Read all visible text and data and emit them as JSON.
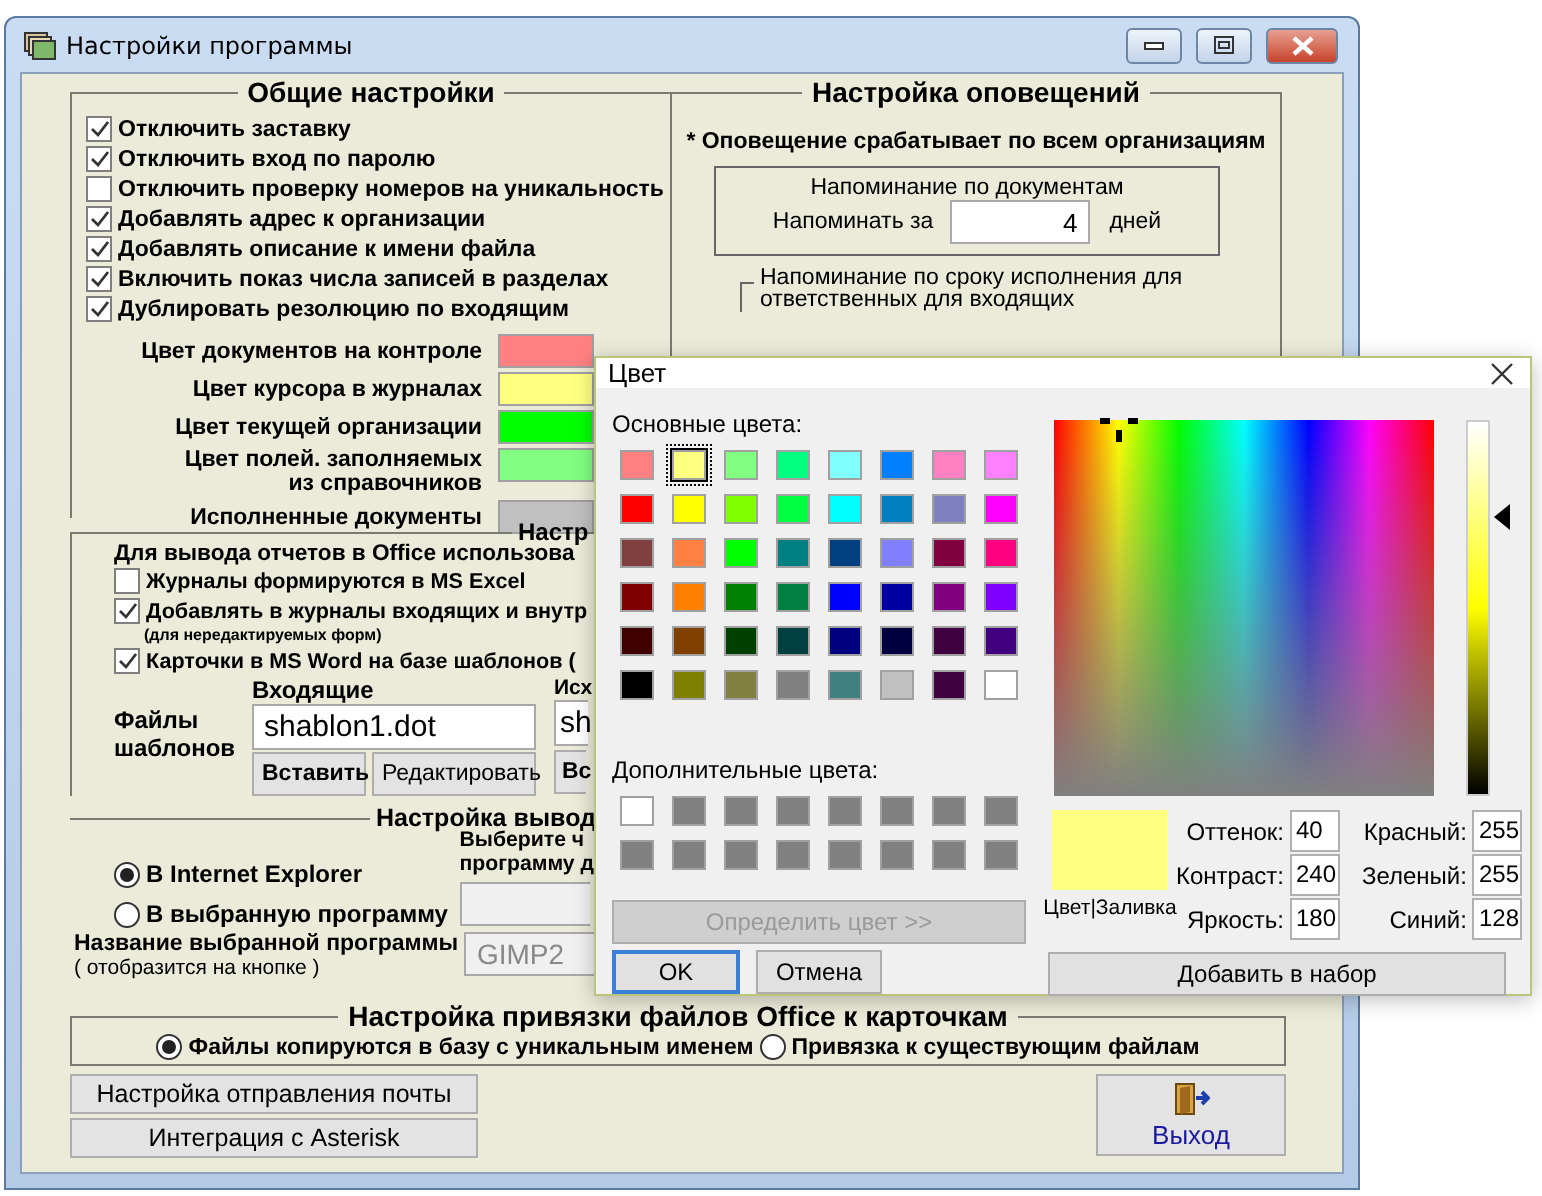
{
  "window": {
    "title": "Настройки программы"
  },
  "general": {
    "title": "Общие настройки",
    "options": [
      {
        "label": "Отключить заставку",
        "checked": true
      },
      {
        "label": "Отключить вход по паролю",
        "checked": true
      },
      {
        "label": "Отключить проверку номеров на уникальность",
        "checked": false
      },
      {
        "label": "Добавлять адрес к организации",
        "checked": true
      },
      {
        "label": "Добавлять описание к имени файла",
        "checked": true
      },
      {
        "label": "Включить показ числа записей в разделах",
        "checked": true
      },
      {
        "label": "Дублировать резолюцию по входящим",
        "checked": true
      }
    ],
    "colors": [
      {
        "label": "Цвет документов на контроле",
        "color": "#ff8080"
      },
      {
        "label": "Цвет курсора в журналах",
        "color": "#ffff80"
      },
      {
        "label": "Цвет текущей организации",
        "color": "#00ff00"
      },
      {
        "label": "Цвет полей. заполняемых\nиз справочников",
        "color": "#80ff80"
      },
      {
        "label": "Исполненные документы",
        "color": "#c0c0c0"
      }
    ]
  },
  "notifications": {
    "title": "Настройка оповещений",
    "note": "* Оповещение срабатывает по всем организациям",
    "documents": {
      "title": "Напоминание по документам",
      "label": "Напоминать за",
      "value": "4",
      "unit": "дней"
    },
    "deadline": {
      "title": "Напоминание по сроку исполнения для ответственных для входящих"
    }
  },
  "office": {
    "title": "Настр",
    "intro": "Для вывода отчетов в Office использова",
    "options": [
      {
        "label": "Журналы формируются в MS Excel",
        "checked": false
      },
      {
        "label": "Добавлять в журналы входящих и внутр",
        "checked": true,
        "note": "(для нередактируемых форм)"
      },
      {
        "label": "Карточки в MS Word на базе шаблонов (",
        "checked": true
      }
    ],
    "templates": {
      "label": "Файлы\nшаблонов",
      "incoming": {
        "title": "Входящие",
        "value": "shablon1.dot",
        "buttons": [
          "Вставить",
          "Редактировать"
        ]
      },
      "outgoing": {
        "title": "Исх",
        "value": "sh",
        "buttons": [
          "Вс"
        ]
      }
    }
  },
  "output": {
    "title": "Настройка вывод",
    "choices": [
      {
        "label": "В Internet Explorer",
        "selected": true
      },
      {
        "label": "В выбранную программу",
        "selected": false
      }
    ],
    "hint": "Выберите ч\nпрограмму д",
    "name_label": "Название выбранной программы",
    "name_note": "( отобразится на кнопке )",
    "name_value": "GIMP2"
  },
  "binding": {
    "title": "Настройка привязки файлов Office к карточкам",
    "choices": [
      {
        "label": "Файлы копируются в базу с уникальным именем",
        "selected": true
      },
      {
        "label": "Привязка к существующим файлам",
        "selected": false
      }
    ]
  },
  "buttons": [
    "Настройка отправления почты",
    "Интеграция с Asterisk"
  ],
  "exit": "Выход",
  "color_dialog": {
    "title": "Цвет",
    "basic_label": "Основные цвета:",
    "basic": [
      {
        "color": "#ff8080",
        "selected": false
      },
      {
        "color": "#ffff80",
        "selected": true
      },
      {
        "color": "#80ff80",
        "selected": false
      },
      {
        "color": "#00ff80",
        "selected": false
      },
      {
        "color": "#80ffff",
        "selected": false
      },
      {
        "color": "#0080ff",
        "selected": false
      },
      {
        "color": "#ff80c0",
        "selected": false
      },
      {
        "color": "#ff80ff",
        "selected": false
      },
      {
        "color": "#ff0000",
        "selected": false
      },
      {
        "color": "#ffff00",
        "selected": false
      },
      {
        "color": "#80ff00",
        "selected": false
      },
      {
        "color": "#00ff40",
        "selected": false
      },
      {
        "color": "#00ffff",
        "selected": false
      },
      {
        "color": "#0080c0",
        "selected": false
      },
      {
        "color": "#8080c0",
        "selected": false
      },
      {
        "color": "#ff00ff",
        "selected": false
      },
      {
        "color": "#804040",
        "selected": false
      },
      {
        "color": "#ff8040",
        "selected": false
      },
      {
        "color": "#00ff00",
        "selected": false
      },
      {
        "color": "#008080",
        "selected": false
      },
      {
        "color": "#004080",
        "selected": false
      },
      {
        "color": "#8080ff",
        "selected": false
      },
      {
        "color": "#800040",
        "selected": false
      },
      {
        "color": "#ff0080",
        "selected": false
      },
      {
        "color": "#800000",
        "selected": false
      },
      {
        "color": "#ff8000",
        "selected": false
      },
      {
        "color": "#008000",
        "selected": false
      },
      {
        "color": "#008040",
        "selected": false
      },
      {
        "color": "#0000ff",
        "selected": false
      },
      {
        "color": "#0000a0",
        "selected": false
      },
      {
        "color": "#800080",
        "selected": false
      },
      {
        "color": "#8000ff",
        "selected": false
      },
      {
        "color": "#400000",
        "selected": false
      },
      {
        "color": "#804000",
        "selected": false
      },
      {
        "color": "#004000",
        "selected": false
      },
      {
        "color": "#004040",
        "selected": false
      },
      {
        "color": "#000080",
        "selected": false
      },
      {
        "color": "#000040",
        "selected": false
      },
      {
        "color": "#400040",
        "selected": false
      },
      {
        "color": "#400080",
        "selected": false
      },
      {
        "color": "#000000",
        "selected": false
      },
      {
        "color": "#808000",
        "selected": false
      },
      {
        "color": "#808040",
        "selected": false
      },
      {
        "color": "#808080",
        "selected": false
      },
      {
        "color": "#408080",
        "selected": false
      },
      {
        "color": "#c0c0c0",
        "selected": false
      },
      {
        "color": "#400040",
        "selected": false
      },
      {
        "color": "#ffffff",
        "selected": false
      }
    ],
    "custom_label": "Дополнительные цвета:",
    "custom": [
      {
        "color": "#ffffff"
      },
      {
        "color": "#808080"
      },
      {
        "color": "#808080"
      },
      {
        "color": "#808080"
      },
      {
        "color": "#808080"
      },
      {
        "color": "#808080"
      },
      {
        "color": "#808080"
      },
      {
        "color": "#808080"
      },
      {
        "color": "#808080"
      },
      {
        "color": "#808080"
      },
      {
        "color": "#808080"
      },
      {
        "color": "#808080"
      },
      {
        "color": "#808080"
      },
      {
        "color": "#808080"
      },
      {
        "color": "#808080"
      },
      {
        "color": "#808080"
      }
    ],
    "define_button": {
      "label": "Определить цвет >>",
      "disabled": true
    },
    "ok": "OK",
    "cancel": "Отмена",
    "preview": {
      "label": "Цвет|Заливка",
      "color": "#ffff80"
    },
    "luminance": {
      "level": 0.75
    },
    "hsl": [
      {
        "label": "Оттенок:",
        "value": "40"
      },
      {
        "label": "Контраст:",
        "value": "240"
      },
      {
        "label": "Яркость:",
        "value": "180"
      }
    ],
    "rgb": [
      {
        "label": "Красный:",
        "value": "255"
      },
      {
        "label": "Зеленый:",
        "value": "255"
      },
      {
        "label": "Синий:",
        "value": "128"
      }
    ],
    "add_button": "Добавить в набор"
  }
}
